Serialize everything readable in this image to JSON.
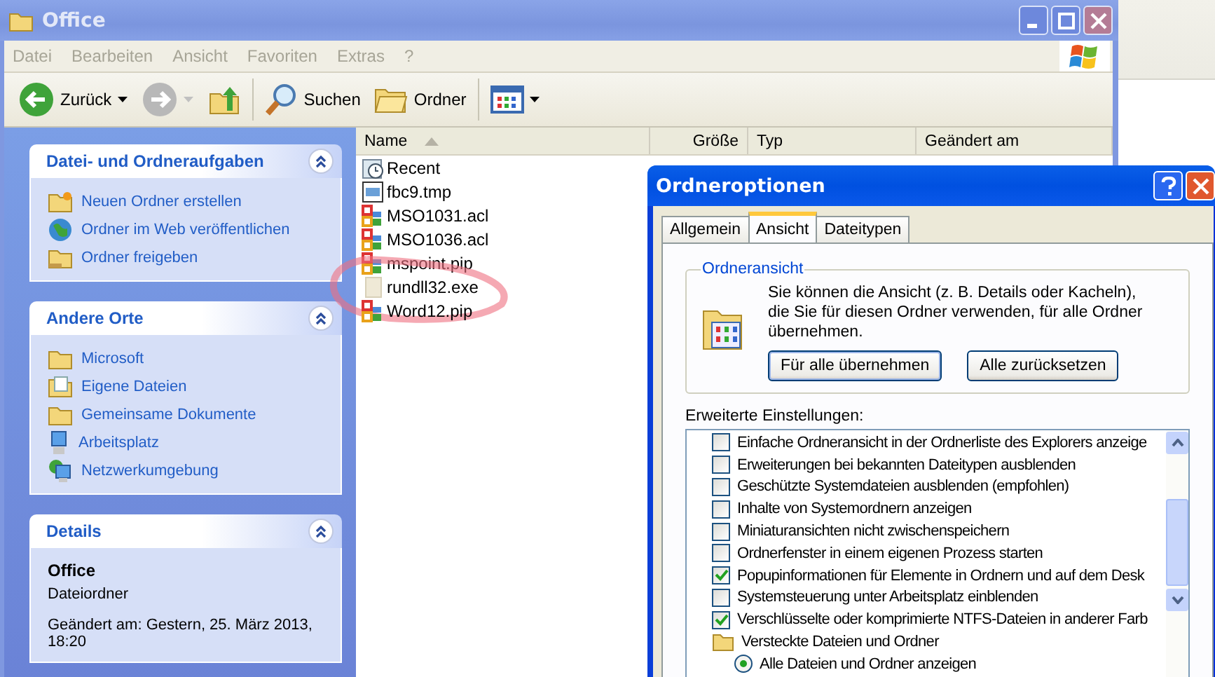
{
  "window": {
    "title": "Office"
  },
  "menu": [
    "Datei",
    "Bearbeiten",
    "Ansicht",
    "Favoriten",
    "Extras",
    "?"
  ],
  "toolbar": [
    {
      "kind": "back",
      "label": "Zurück"
    },
    {
      "kind": "forward"
    },
    {
      "kind": "up"
    },
    {
      "kind": "search",
      "label": "Suchen"
    },
    {
      "kind": "folders",
      "label": "Ordner"
    },
    {
      "kind": "views"
    }
  ],
  "sidebar": {
    "panels": [
      {
        "title": "Datei- und Ordneraufgaben",
        "expanded": true,
        "items": [
          {
            "kind": "new-folder",
            "label": "Neuen Ordner erstellen"
          },
          {
            "kind": "web",
            "label": "Ordner im Web veröffentlichen"
          },
          {
            "kind": "share",
            "label": "Ordner freigeben"
          }
        ]
      },
      {
        "title": "Andere Orte",
        "expanded": true,
        "items": [
          {
            "kind": "folder",
            "label": "Microsoft"
          },
          {
            "kind": "documents",
            "label": "Eigene Dateien"
          },
          {
            "kind": "folder",
            "label": "Gemeinsame Dokumente"
          },
          {
            "kind": "computer",
            "label": "Arbeitsplatz"
          },
          {
            "kind": "network",
            "label": "Netzwerkumgebung"
          }
        ]
      },
      {
        "title": "Details",
        "expanded": true,
        "name": "Office",
        "type": "Dateiordner",
        "modified": "Geändert am: Gestern, 25. März 2013, 18:20"
      }
    ]
  },
  "file_list": {
    "columns": [
      {
        "label": "Name",
        "sorted": true
      },
      {
        "label": "Größe",
        "sorted": false
      },
      {
        "label": "Typ",
        "sorted": false
      },
      {
        "label": "Geändert am",
        "sorted": false
      }
    ],
    "files": [
      {
        "kind": "recent",
        "name": "Recent"
      },
      {
        "kind": "tmp",
        "name": "fbc9.tmp"
      },
      {
        "kind": "office",
        "name": "MSO1031.acl"
      },
      {
        "kind": "office",
        "name": "MSO1036.acl"
      },
      {
        "kind": "office",
        "name": "mspoint.pip"
      },
      {
        "kind": "blank",
        "name": "rundll32.exe",
        "circled": true
      },
      {
        "kind": "office",
        "name": "Word12.pip"
      }
    ]
  },
  "dialog": {
    "title": "Ordneroptionen",
    "tabs": [
      {
        "label": "Allgemein",
        "selected": false
      },
      {
        "label": "Ansicht",
        "selected": true
      },
      {
        "label": "Dateitypen",
        "selected": false
      }
    ],
    "group_title": "Ordneransicht",
    "description": "Sie können die Ansicht (z. B. Details oder Kacheln), die Sie für diesen Ordner verwenden, für alle Ordner übernehmen.",
    "buttons": [
      "Für alle übernehmen",
      "Alle zurücksetzen"
    ],
    "advanced_label": "Erweiterte Einstellungen:",
    "settings": [
      {
        "kind": "checkbox",
        "label": "Einfache Ordneransicht in der Ordnerliste des Explorers anzeige",
        "checked": false
      },
      {
        "kind": "checkbox",
        "label": "Erweiterungen bei bekannten Dateitypen ausblenden",
        "checked": false
      },
      {
        "kind": "checkbox",
        "label": "Geschützte Systemdateien ausblenden (empfohlen)",
        "checked": false
      },
      {
        "kind": "checkbox",
        "label": "Inhalte von Systemordnern anzeigen",
        "checked": false
      },
      {
        "kind": "checkbox",
        "label": "Miniaturansichten nicht zwischenspeichern",
        "checked": false
      },
      {
        "kind": "checkbox",
        "label": "Ordnerfenster in einem eigenen Prozess starten",
        "checked": false
      },
      {
        "kind": "checkbox",
        "label": "Popupinformationen für Elemente in Ordnern und auf dem Desk",
        "checked": true
      },
      {
        "kind": "checkbox",
        "label": "Systemsteuerung unter Arbeitsplatz einblenden",
        "checked": false
      },
      {
        "kind": "checkbox",
        "label": "Verschlüsselte oder komprimierte NTFS-Dateien in anderer Farb",
        "checked": true
      },
      {
        "kind": "folder",
        "label": "Versteckte Dateien und Ordner"
      },
      {
        "kind": "radio",
        "label": "Alle Dateien und Ordner anzeigen",
        "selected": true
      }
    ]
  }
}
